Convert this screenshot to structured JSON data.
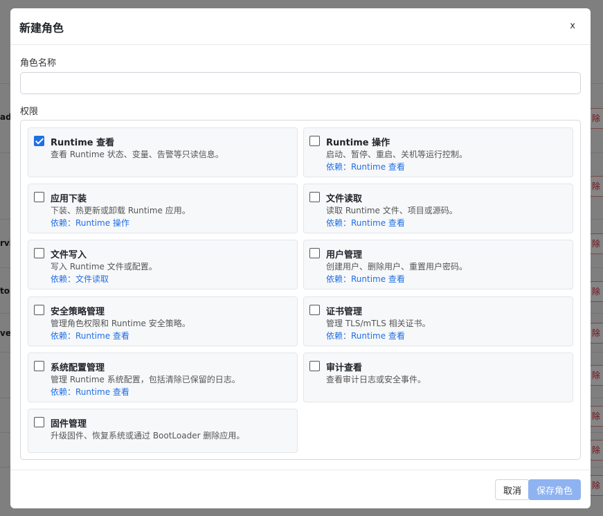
{
  "background": {
    "left_texts": [
      "ad",
      "rvi",
      "tor",
      "ver"
    ],
    "delete_label": "除"
  },
  "modal": {
    "title": "新建角色",
    "close_label": "x",
    "name_label": "角色名称",
    "name_value": "",
    "permissions_label": "权限",
    "permissions": [
      {
        "title": "Runtime 查看",
        "desc": "查看 Runtime 状态、变量、告警等只读信息。",
        "dep": "",
        "checked": true
      },
      {
        "title": "Runtime 操作",
        "desc": "启动、暂停、重启、关机等运行控制。",
        "dep": "依赖：Runtime 查看",
        "checked": false
      },
      {
        "title": "应用下装",
        "desc": "下装、热更新或卸载 Runtime 应用。",
        "dep": "依赖：Runtime 操作",
        "checked": false
      },
      {
        "title": "文件读取",
        "desc": "读取 Runtime 文件、项目或源码。",
        "dep": "依赖：Runtime 查看",
        "checked": false
      },
      {
        "title": "文件写入",
        "desc": "写入 Runtime 文件或配置。",
        "dep": "依赖：文件读取",
        "checked": false
      },
      {
        "title": "用户管理",
        "desc": "创建用户、删除用户、重置用户密码。",
        "dep": "依赖：Runtime 查看",
        "checked": false
      },
      {
        "title": "安全策略管理",
        "desc": "管理角色权限和 Runtime 安全策略。",
        "dep": "依赖：Runtime 查看",
        "checked": false
      },
      {
        "title": "证书管理",
        "desc": "管理 TLS/mTLS 相关证书。",
        "dep": "依赖：Runtime 查看",
        "checked": false
      },
      {
        "title": "系统配置管理",
        "desc": "管理 Runtime 系统配置，包括清除已保留的日志。",
        "dep": "依赖：Runtime 查看",
        "checked": false
      },
      {
        "title": "审计查看",
        "desc": "查看审计日志或安全事件。",
        "dep": "",
        "checked": false
      },
      {
        "title": "固件管理",
        "desc": "升级固件、恢复系统或通过 BootLoader 删除应用。",
        "dep": "",
        "checked": false
      }
    ],
    "cancel_label": "取消",
    "save_label": "保存角色"
  }
}
